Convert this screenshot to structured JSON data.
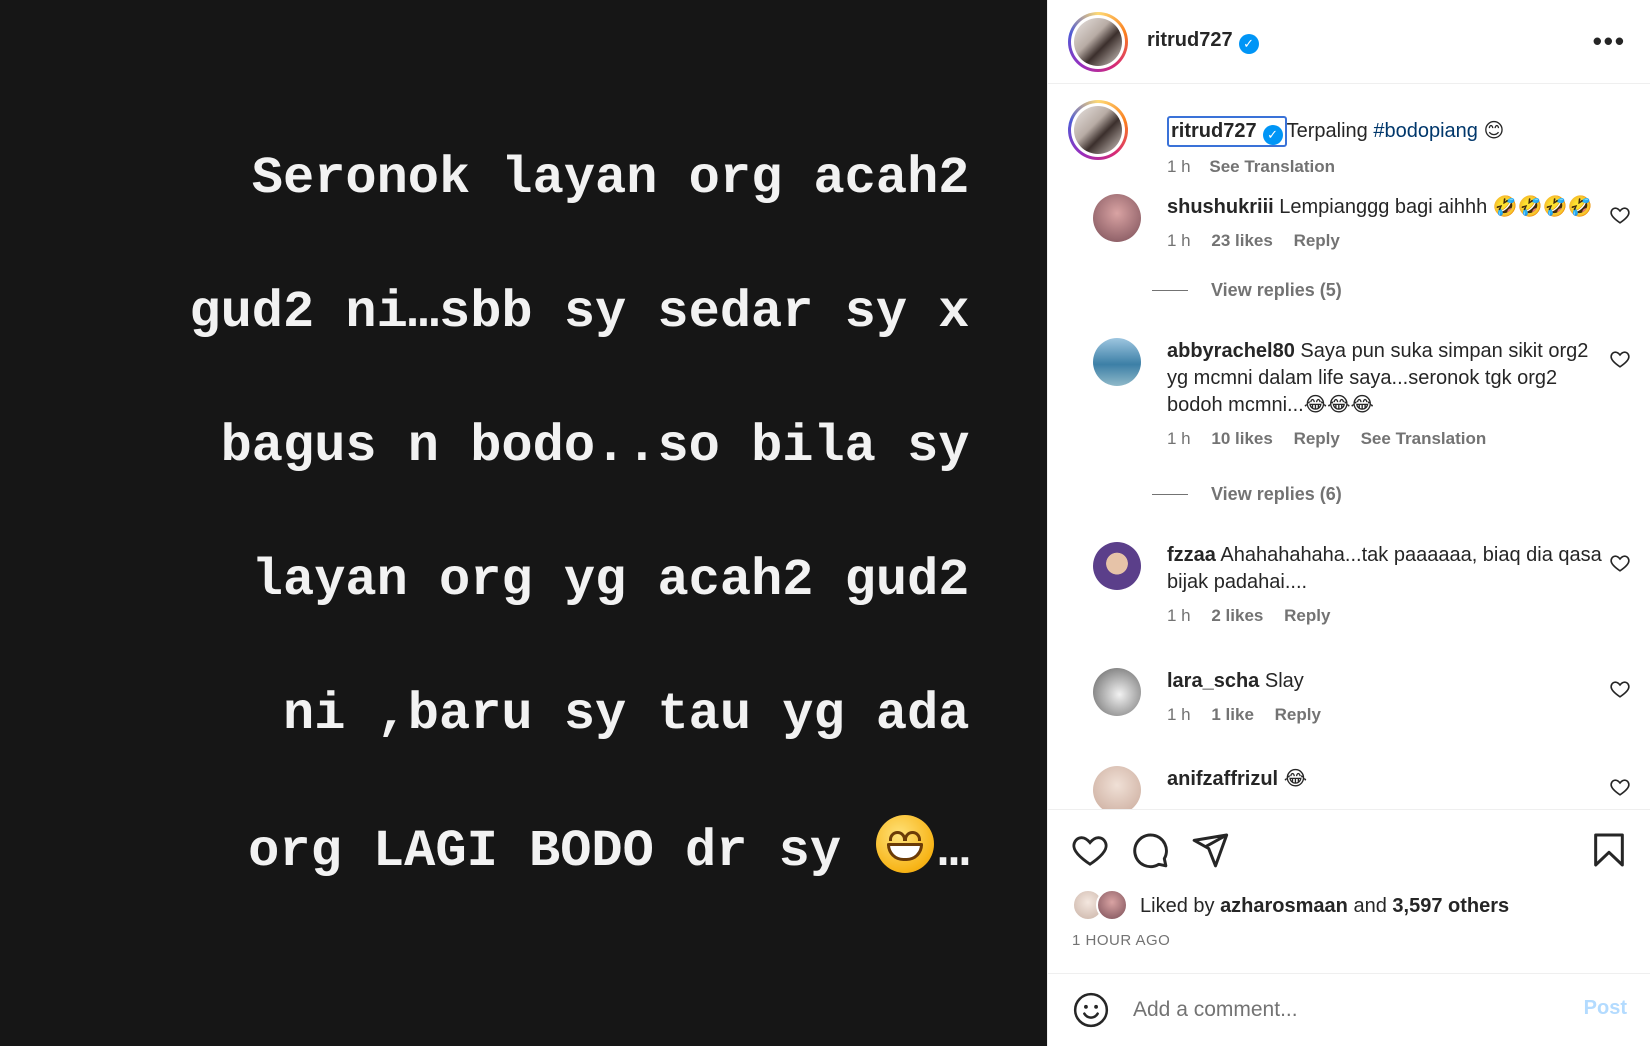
{
  "media": {
    "lines": [
      "Seronok layan org acah2",
      "gud2 ni…sbb sy sedar sy x",
      "bagus n bodo..so bila sy",
      "layan org yg acah2 gud2",
      "ni ,baru sy tau yg ada",
      "org LAGI BODO dr sy"
    ],
    "last_line_suffix": "…",
    "emoji": "grinning-face-icon"
  },
  "header": {
    "username": "ritrud727",
    "verified": true,
    "more_icon": "more-options-icon"
  },
  "caption": {
    "username": "ritrud727",
    "text": "Terpaling",
    "hashtag": "#bodopiang",
    "emoji": "😊",
    "time": "1 h",
    "translate": "See Translation"
  },
  "comments": [
    {
      "user": "shushukriii",
      "text": "Lempianggg bagi aihhh 🤣🤣🤣🤣",
      "time": "1 h",
      "likes": "23 likes",
      "reply": "Reply",
      "translate": "",
      "view_replies": "View replies (5)",
      "avatar_color": "#b78b8b"
    },
    {
      "user": "abbyrachel80",
      "text": "Saya pun suka simpan sikit org2 yg mcmni dalam life saya...seronok tgk org2 bodoh mcmni...😂😂😂",
      "time": "1 h",
      "likes": "10 likes",
      "reply": "Reply",
      "translate": "See Translation",
      "view_replies": "View replies (6)",
      "avatar_color": "#4c8fb0"
    },
    {
      "user": "fzzaa",
      "text": "Ahahahahaha...tak paaaaaa, biaq dia qasa bijak padahai....",
      "time": "1 h",
      "likes": "2 likes",
      "reply": "Reply",
      "translate": "",
      "view_replies": "",
      "avatar_color": "#5b4a8a"
    },
    {
      "user": "lara_scha",
      "text": "Slay",
      "time": "1 h",
      "likes": "1 like",
      "reply": "Reply",
      "translate": "",
      "view_replies": "",
      "avatar_color": "#9a9a9a"
    },
    {
      "user": "anifzaffrizul",
      "text": "😂",
      "time": "",
      "likes": "",
      "reply": "",
      "translate": "",
      "view_replies": "",
      "avatar_color": "#d8c3b8"
    }
  ],
  "actions": {
    "liked_prefix": "Liked by",
    "liked_user": "azharosmaan",
    "liked_and": "and",
    "liked_others": "3,597 others",
    "time_ago": "1 HOUR AGO"
  },
  "add_comment": {
    "placeholder": "Add a comment...",
    "post_label": "Post"
  },
  "colors": {
    "media_bg": "#161616",
    "link_blue": "#00376b",
    "verified_blue": "#0095f6",
    "post_disabled": "#b3dbff",
    "secondary_text": "#737373"
  }
}
